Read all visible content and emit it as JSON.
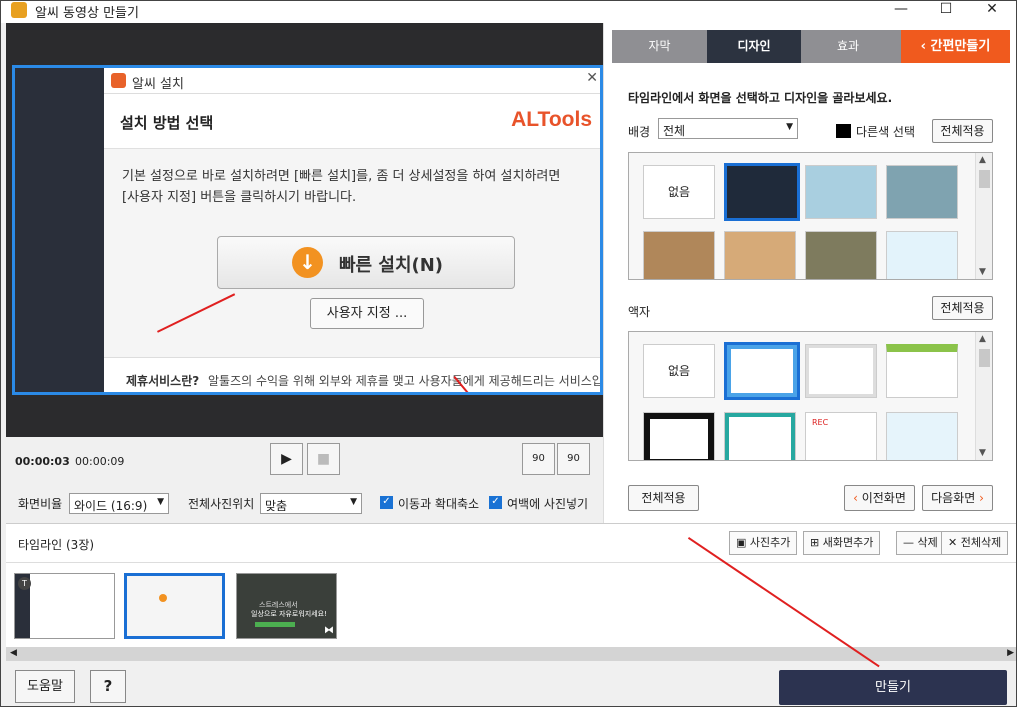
{
  "window": {
    "title": "알씨 동영상 만들기"
  },
  "preview": {
    "dialog_title": "알씨 설치",
    "heading": "설치 방법 선택",
    "brand": "ALTools",
    "desc_line1": "기본 설정으로 바로 설치하려면 [빠른 설치]를, 좀 더 상세설정을 하여 설치하려면",
    "desc_line2": "[사용자 지정] 버튼을 클릭하시기 바랍니다.",
    "fast_install": "빠른 설치(N)",
    "custom_install": "사용자 지정 ...",
    "footer_link": "제휴서비스란?",
    "footer_text": "알툴즈의 수익을 위해 외부와 제휴를 맺고 사용자들에게 제공해드리는 서비스입니다"
  },
  "controls": {
    "time_current": "00:00:03",
    "time_total": "00:00:09",
    "rotate_left": "90",
    "rotate_right": "90"
  },
  "options": {
    "ratio_label": "화면비율",
    "ratio_value": "와이드 (16:9)",
    "photo_pos_label": "전체사진위치",
    "photo_pos_value": "맞춤",
    "zoom_label": "이동과 확대축소",
    "margin_label": "여백에 사진넣기"
  },
  "tabs": [
    {
      "label": "자막"
    },
    {
      "label": "디자인"
    },
    {
      "label": "효과"
    }
  ],
  "quick_make": "간편만들기",
  "design": {
    "instruction": "타임라인에서 화면을 선택하고 디자인을 골라보세요.",
    "bg_label": "배경",
    "bg_select": "전체",
    "other_color": "다른색 선택",
    "apply_all": "전체적용",
    "frame_label": "액자",
    "none": "없음",
    "rec": "REC"
  },
  "nav": {
    "apply_all": "전체적용",
    "prev": "이전화면",
    "next": "다음화면"
  },
  "timeline": {
    "title": "타임라인",
    "count": "(3장)",
    "add_photo": "사진추가",
    "add_new": "새화면추가",
    "delete": "삭제",
    "delete_all": "전체삭제",
    "thumb3_line1": "스트레스에서",
    "thumb3_line2": "일상으로 자유로워지세요!"
  },
  "bottom": {
    "help": "도움말",
    "question": "?",
    "make": "만들기"
  },
  "colors": {
    "accent_orange": "#f05a1e",
    "selected_blue": "#1a6fd4",
    "make_button": "#2c3350",
    "brand_orange": "#e8532a"
  }
}
